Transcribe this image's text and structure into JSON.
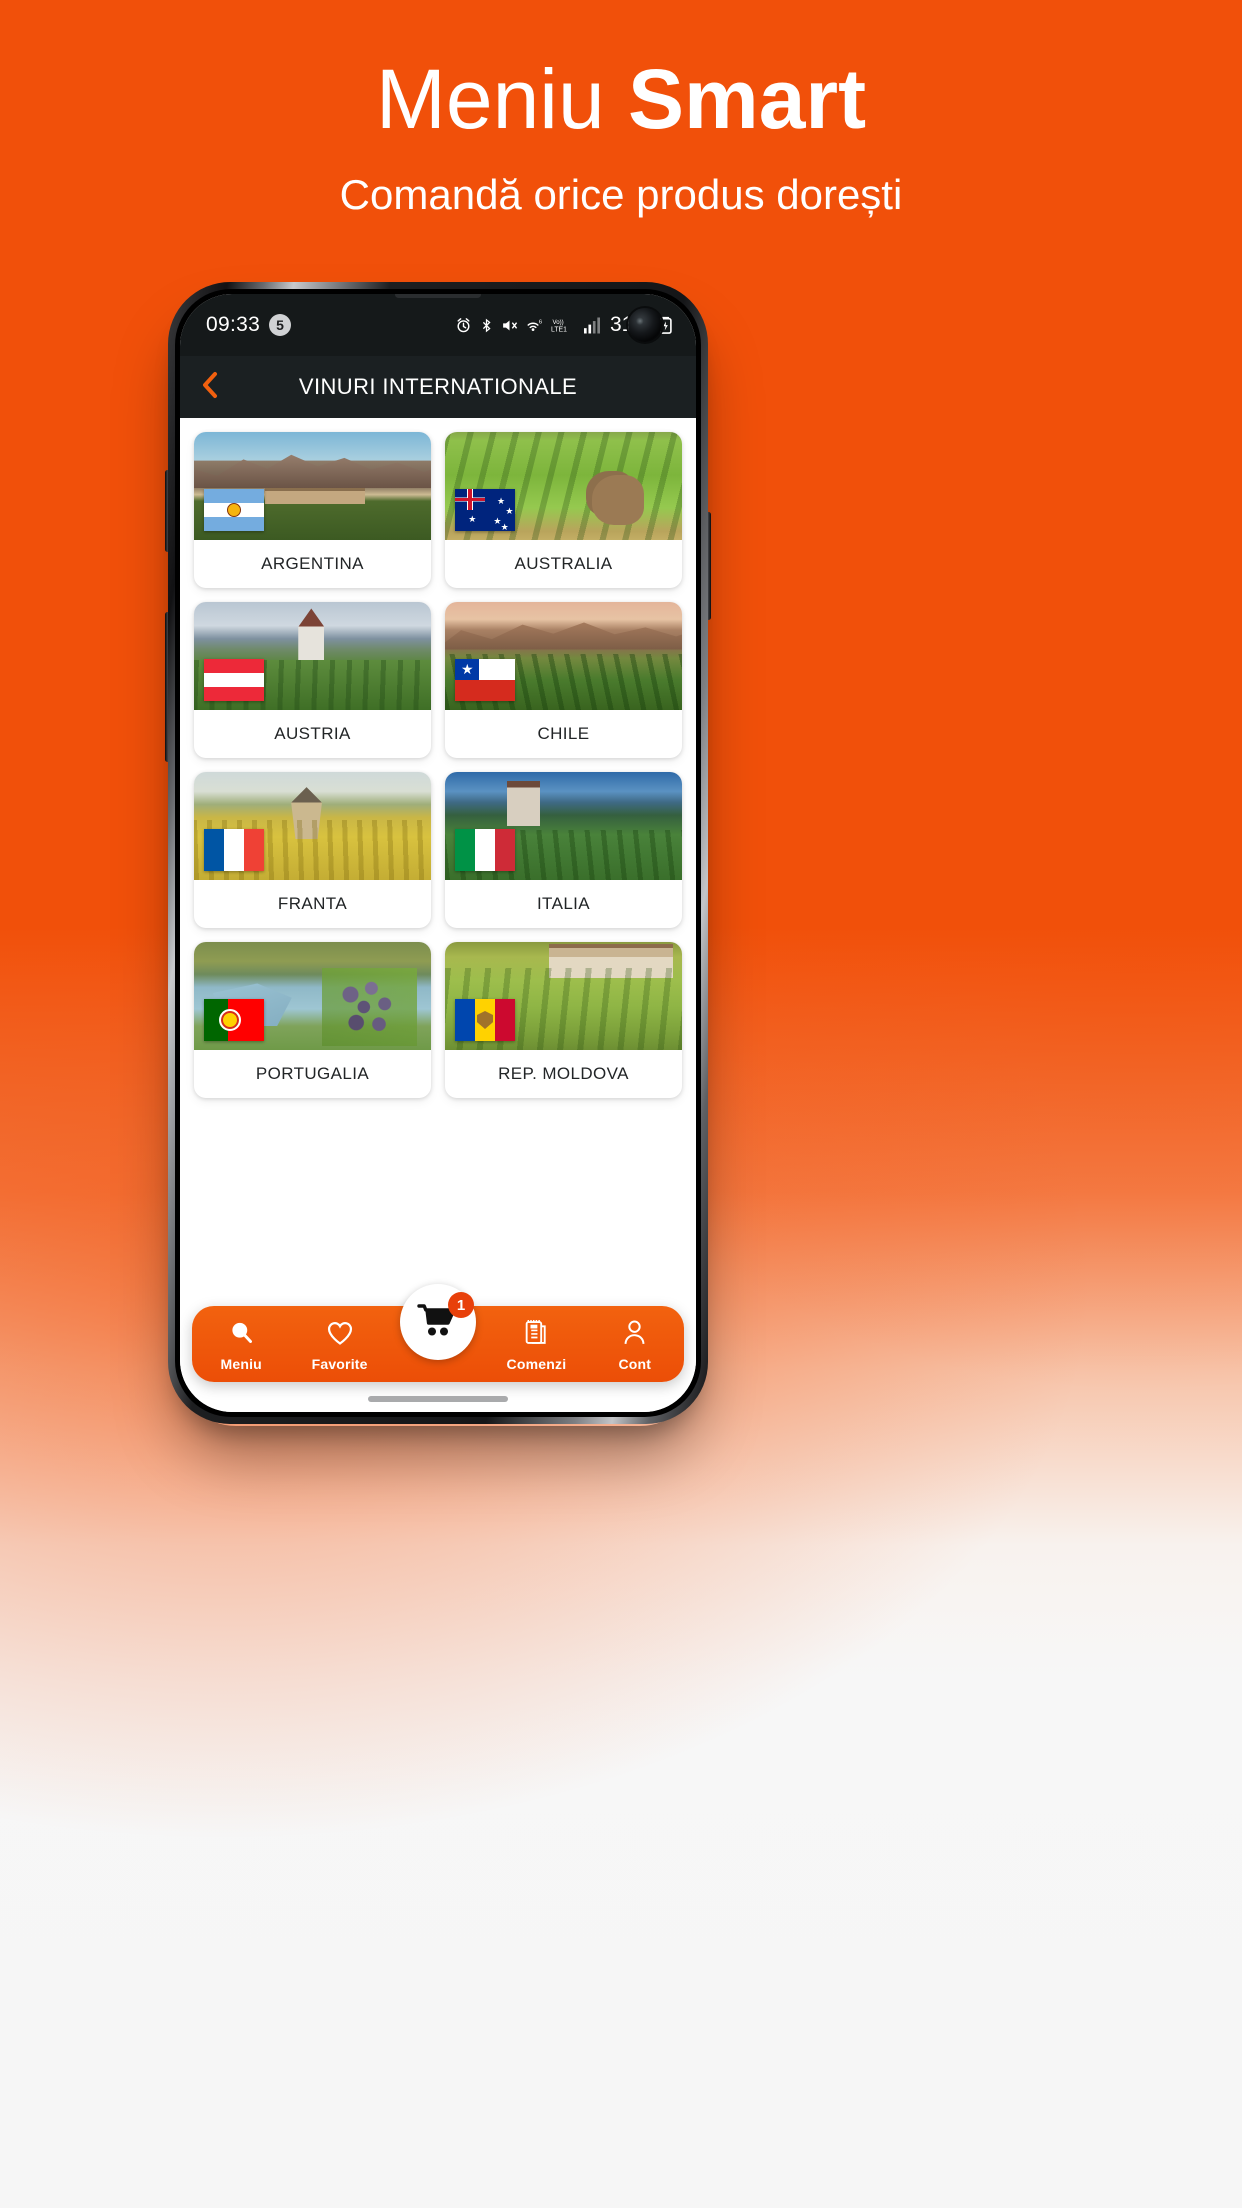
{
  "hero": {
    "title_regular": "Meniu ",
    "title_bold": "Smart",
    "subtitle": "Comandă orice produs dorești"
  },
  "colors": {
    "brand_orange": "#F1500A",
    "nav_orange": "#EC4E07",
    "badge_red": "#E8400A",
    "appbar_dark": "#1B2022",
    "statusbar_dark": "#15191A"
  },
  "phone": {
    "statusbar": {
      "time": "09:33",
      "notification_count": "5",
      "battery_percent": "31%",
      "icons": [
        "alarm-icon",
        "bluetooth-icon",
        "mute-icon",
        "wifi-icon",
        "volte-icon",
        "signal-icon",
        "battery-charging-icon"
      ],
      "network_label": "LTE1",
      "volte_label": "Vo))",
      "wifi_badge": "6"
    },
    "appbar": {
      "back_icon": "chevron-left-icon",
      "title": "VINURI INTERNATIONALE"
    },
    "grid": {
      "items": [
        {
          "label": "ARGENTINA",
          "flag": "flag-argentina",
          "scene": "andes-winery"
        },
        {
          "label": "AUSTRALIA",
          "flag": "flag-australia",
          "scene": "vineyard-kangaroo"
        },
        {
          "label": "AUSTRIA",
          "flag": "flag-austria",
          "scene": "village-church-vineyard"
        },
        {
          "label": "CHILE",
          "flag": "flag-chile",
          "scene": "mountain-vineyard-sunset"
        },
        {
          "label": "FRANTA",
          "flag": "flag-france",
          "scene": "windmill-autumn-vineyard"
        },
        {
          "label": "ITALIA",
          "flag": "flag-italy",
          "scene": "castle-alps-terraces"
        },
        {
          "label": "PORTUGALIA",
          "flag": "flag-portugal",
          "scene": "douro-river-grapes"
        },
        {
          "label": "REP. MOLDOVA",
          "flag": "flag-moldova",
          "scene": "vineyard-estate"
        }
      ]
    },
    "bottomnav": {
      "items": [
        {
          "label": "Meniu",
          "icon": "search-icon"
        },
        {
          "label": "Favorite",
          "icon": "heart-icon"
        },
        {
          "label": "Comenzi",
          "icon": "clipboard-list-icon"
        },
        {
          "label": "Cont",
          "icon": "user-icon"
        }
      ],
      "cart": {
        "icon": "shopping-cart-icon",
        "badge": "1"
      }
    }
  }
}
